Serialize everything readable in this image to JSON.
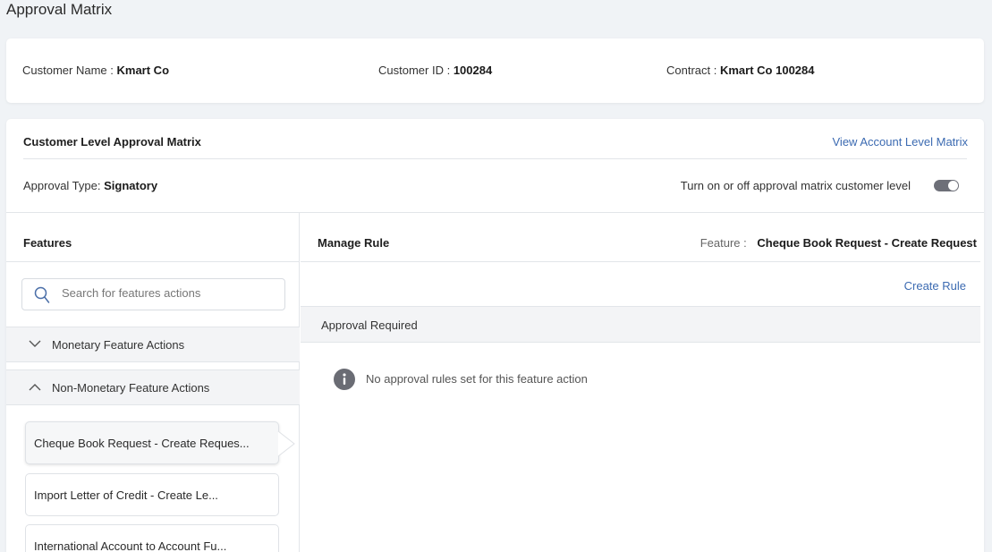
{
  "page_title": "Approval Matrix",
  "customer_info": {
    "name_label": "Customer Name :",
    "name_value": "Kmart Co",
    "id_label": "Customer ID :",
    "id_value": "100284",
    "contract_label": "Contract :",
    "contract_value": "Kmart Co 100284"
  },
  "matrix": {
    "title": "Customer Level Approval Matrix",
    "view_account_link": "View Account Level Matrix",
    "approval_type_label": "Approval Type:",
    "approval_type_value": "Signatory",
    "toggle_label": "Turn on or off approval matrix customer level",
    "toggle_on": true
  },
  "features": {
    "header": "Features",
    "search_placeholder": "Search for features actions",
    "groups": [
      {
        "label": "Monetary Feature Actions",
        "expanded": false
      },
      {
        "label": "Non-Monetary Feature Actions",
        "expanded": true
      }
    ],
    "items": [
      {
        "label": "Cheque Book Request - Create Reques...",
        "selected": true
      },
      {
        "label": "Import Letter of Credit - Create Le...",
        "selected": false
      },
      {
        "label": "International Account to Account Fu...",
        "selected": false
      }
    ]
  },
  "manage_rule": {
    "header": "Manage Rule",
    "feature_label": "Feature :",
    "feature_value": "Cheque Book Request - Create Request",
    "create_rule": "Create Rule",
    "approval_required": "Approval Required",
    "empty_message": "No  approval rules set for this feature action"
  },
  "colors": {
    "link": "#3b6ab1",
    "toggle": "#6d6f78",
    "info_icon": "#6a6c74"
  }
}
